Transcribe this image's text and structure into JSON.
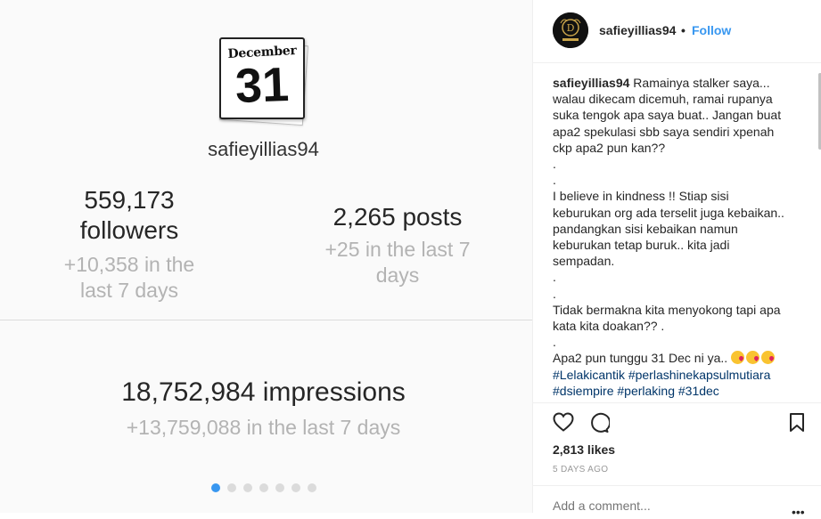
{
  "media": {
    "calendar": {
      "month": "December",
      "day": "31"
    },
    "username": "safieyillias94",
    "followers": {
      "count": "559,173",
      "label": "followers",
      "delta_line1": "+10,358 in the",
      "delta_line2": "last 7 days"
    },
    "posts": {
      "value": "2,265 posts",
      "delta_line1": "+25 in the last 7",
      "delta_line2": "days"
    },
    "impressions": {
      "value": "18,752,984 impressions",
      "delta": "+13,759,088 in the last 7 days"
    },
    "carousel": {
      "total": 7,
      "active_index": 0
    }
  },
  "post": {
    "header": {
      "username": "safieyillias94",
      "separator": "•",
      "follow_label": "Follow"
    },
    "caption": {
      "username": "safieyillias94",
      "lines": [
        "Ramainya stalker saya...",
        "walau dikecam dicemuh, ramai rupanya",
        "suka tengok apa saya buat.. Jangan buat",
        "apa2 spekulasi sbb saya sendiri xpenah",
        "ckp apa2 pun kan??",
        ".",
        ".",
        "I believe in kindness !! Stiap sisi",
        "keburukan org ada terselit juga kebaikan..",
        "pandangkan sisi kebaikan namun",
        "keburukan tetap buruk.. kita jadi",
        "sempadan.",
        ".",
        ".",
        "Tidak bermakna kita menyokong tapi apa",
        "kata kita doakan?? .",
        ".",
        "Apa2 pun tunggu 31 Dec ni ya.."
      ],
      "hashtags_line1": [
        "#Lelakicantik",
        "#perlashinekapsulmutiara"
      ],
      "hashtags_line2": [
        "#dsiempire",
        "#perlaking",
        "#31dec"
      ]
    },
    "likes": "2,813 likes",
    "time_ago": "5 DAYS AGO",
    "comment_placeholder": "Add a comment...",
    "more": "•••"
  },
  "colors": {
    "accent": "#3897f0",
    "hashtag": "#003569",
    "muted": "#b3b3b3"
  }
}
